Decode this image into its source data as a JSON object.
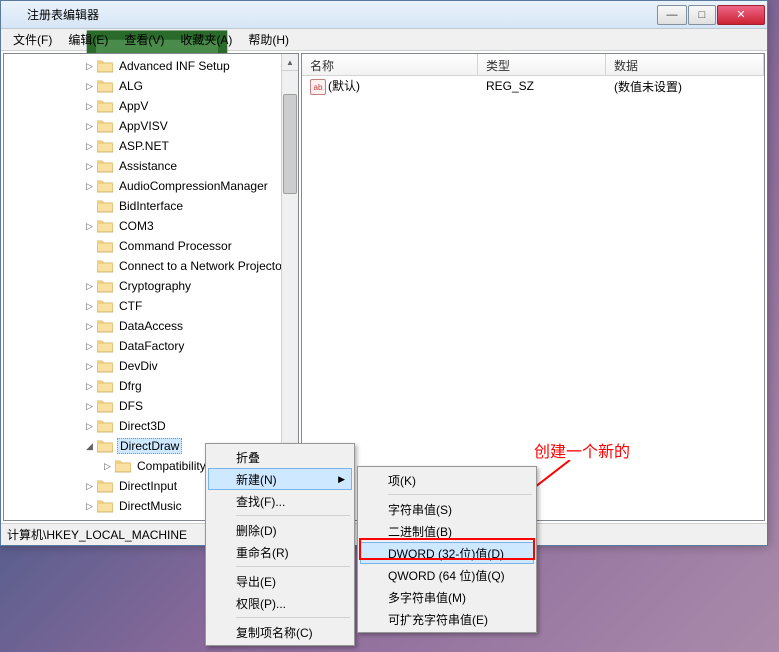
{
  "window": {
    "title": "注册表编辑器",
    "buttons": {
      "min": "—",
      "max": "□",
      "close": "✕"
    }
  },
  "menubar": {
    "file": "文件(F)",
    "edit": "编辑(E)",
    "view": "查看(V)",
    "favorites": "收藏夹(A)",
    "help": "帮助(H)"
  },
  "tree": {
    "items": [
      {
        "label": "Advanced INF Setup",
        "level": 0,
        "expander": "▷"
      },
      {
        "label": "ALG",
        "level": 0,
        "expander": "▷"
      },
      {
        "label": "AppV",
        "level": 0,
        "expander": "▷"
      },
      {
        "label": "AppVISV",
        "level": 0,
        "expander": "▷"
      },
      {
        "label": "ASP.NET",
        "level": 0,
        "expander": "▷"
      },
      {
        "label": "Assistance",
        "level": 0,
        "expander": "▷"
      },
      {
        "label": "AudioCompressionManager",
        "level": 0,
        "expander": "▷"
      },
      {
        "label": "BidInterface",
        "level": 0,
        "expander": ""
      },
      {
        "label": "COM3",
        "level": 0,
        "expander": "▷"
      },
      {
        "label": "Command Processor",
        "level": 0,
        "expander": ""
      },
      {
        "label": "Connect to a Network Projector",
        "level": 0,
        "expander": ""
      },
      {
        "label": "Cryptography",
        "level": 0,
        "expander": "▷"
      },
      {
        "label": "CTF",
        "level": 0,
        "expander": "▷"
      },
      {
        "label": "DataAccess",
        "level": 0,
        "expander": "▷"
      },
      {
        "label": "DataFactory",
        "level": 0,
        "expander": "▷"
      },
      {
        "label": "DevDiv",
        "level": 0,
        "expander": "▷"
      },
      {
        "label": "Dfrg",
        "level": 0,
        "expander": "▷"
      },
      {
        "label": "DFS",
        "level": 0,
        "expander": "▷"
      },
      {
        "label": "Direct3D",
        "level": 0,
        "expander": "▷"
      },
      {
        "label": "DirectDraw",
        "level": 0,
        "expander": "◢",
        "selected": true
      },
      {
        "label": "Compatibility",
        "level": 1,
        "expander": "▷"
      },
      {
        "label": "DirectInput",
        "level": 0,
        "expander": "▷"
      },
      {
        "label": "DirectMusic",
        "level": 0,
        "expander": "▷"
      }
    ]
  },
  "list": {
    "headers": {
      "name": "名称",
      "type": "类型",
      "data": "数据"
    },
    "rows": [
      {
        "icon": "ab",
        "name": "(默认)",
        "type": "REG_SZ",
        "data": "(数值未设置)"
      }
    ]
  },
  "statusbar": {
    "path": "计算机\\HKEY_LOCAL_MACHINE"
  },
  "context_menu": {
    "collapse": "折叠",
    "new": "新建(N)",
    "find": "查找(F)...",
    "delete": "删除(D)",
    "rename": "重命名(R)",
    "export": "导出(E)",
    "permissions": "权限(P)...",
    "copy_key_name": "复制项名称(C)"
  },
  "submenu": {
    "key": "项(K)",
    "string": "字符串值(S)",
    "binary": "二进制值(B)",
    "dword": "DWORD (32-位)值(D)",
    "qword": "QWORD (64 位)值(Q)",
    "multi_string": "多字符串值(M)",
    "expand_string": "可扩充字符串值(E)"
  },
  "annotation": {
    "text": "创建一个新的"
  }
}
